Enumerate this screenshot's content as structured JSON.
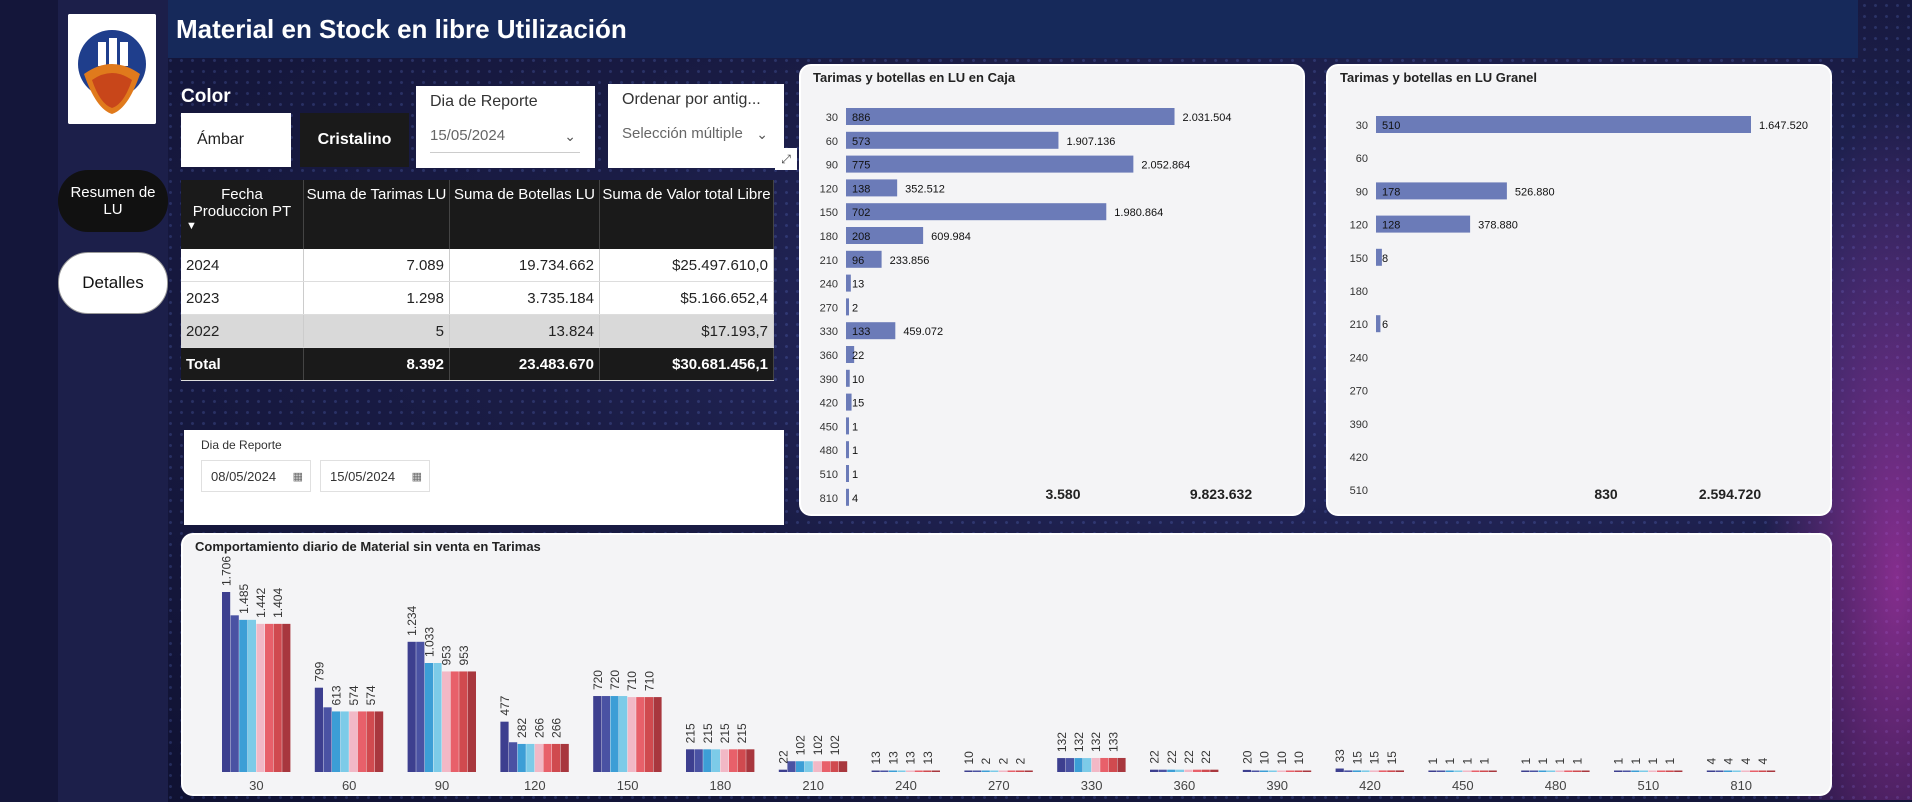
{
  "title": "Material en Stock en libre Utilización",
  "logo": {
    "alt": "Perlas Tierra Blanca logo"
  },
  "nav": {
    "resumen": "Resumen de LU",
    "detalles": "Detalles"
  },
  "filters": {
    "color_label": "Color",
    "color_options": [
      "Ámbar",
      "Cristalino"
    ],
    "dia_label": "Dia de Reporte",
    "dia_value": "15/05/2024",
    "ordenar_label": "Ordenar por antig...",
    "ordenar_value": "Selección múltiple"
  },
  "table": {
    "headers": [
      "Fecha Produccion PT",
      "Suma de Tarimas LU",
      "Suma de Botellas LU",
      "Suma de Valor total Libre"
    ],
    "rows": [
      [
        "2024",
        "7.089",
        "19.734.662",
        "$25.497.610,0"
      ],
      [
        "2023",
        "1.298",
        "3.735.184",
        "$5.166.652,4"
      ],
      [
        "2022",
        "5",
        "13.824",
        "$17.193,7"
      ]
    ],
    "total": [
      "Total",
      "8.392",
      "23.483.670",
      "$30.681.456,1"
    ]
  },
  "range": {
    "label": "Dia de Reporte",
    "from": "08/05/2024",
    "to": "15/05/2024"
  },
  "colors": {
    "bar": "#6b7bb8",
    "series": [
      "#3d3f8f",
      "#4a52a3",
      "#3c9ed6",
      "#7ccbe8",
      "#f2b8c6",
      "#e8606a",
      "#d04a4f",
      "#a8373e"
    ]
  },
  "chart_data": [
    {
      "type": "bar",
      "title": "Tarimas y botellas en LU en Caja",
      "categories": [
        "30",
        "60",
        "90",
        "120",
        "150",
        "180",
        "210",
        "240",
        "270",
        "330",
        "360",
        "390",
        "420",
        "450",
        "480",
        "510",
        "810"
      ],
      "series": [
        {
          "values": [
            886,
            573,
            775,
            138,
            702,
            208,
            96,
            13,
            2,
            133,
            22,
            10,
            15,
            1,
            1,
            1,
            4
          ]
        },
        {
          "values": [
            2031504,
            1907136,
            2052864,
            352512,
            1980864,
            609984,
            233856,
            null,
            null,
            459072,
            null,
            null,
            null,
            null,
            null,
            null,
            null
          ]
        }
      ],
      "value_labels": [
        "2.031.504",
        "1.907.136",
        "2.052.864",
        "352.512",
        "1.980.864",
        "609.984",
        "233.856",
        "",
        "",
        "459.072",
        "",
        "",
        "",
        "",
        "",
        "",
        ""
      ],
      "totals": [
        "3.580",
        "9.823.632"
      ]
    },
    {
      "type": "bar",
      "title": "Tarimas y botellas en LU Granel",
      "categories": [
        "30",
        "60",
        "90",
        "120",
        "150",
        "180",
        "210",
        "240",
        "270",
        "390",
        "420",
        "510"
      ],
      "series": [
        {
          "values": [
            510,
            null,
            178,
            128,
            8,
            null,
            6,
            null,
            null,
            null,
            null,
            null
          ]
        },
        {
          "values": [
            1647520,
            null,
            526880,
            378880,
            null,
            null,
            null,
            null,
            null,
            null,
            null,
            null
          ]
        }
      ],
      "value_labels": [
        "1.647.520",
        "",
        "526.880",
        "378.880",
        "",
        "",
        "",
        "",
        "",
        "",
        "",
        ""
      ],
      "totals": [
        "830",
        "2.594.720"
      ]
    },
    {
      "type": "bar",
      "title": "Comportamiento diario de Material sin venta en Tarimas",
      "categories": [
        "30",
        "60",
        "90",
        "120",
        "150",
        "180",
        "210",
        "240",
        "270",
        "330",
        "360",
        "390",
        "420",
        "450",
        "480",
        "510",
        "810"
      ],
      "groups": [
        [
          1706,
          1485,
          1442,
          1442,
          1404,
          1404,
          1404,
          1404
        ],
        [
          799,
          613,
          574,
          574,
          574,
          574,
          574,
          574
        ],
        [
          1234,
          1234,
          1033,
          1033,
          953,
          953,
          953,
          953
        ],
        [
          477,
          282,
          266,
          266,
          266,
          266,
          266,
          266
        ],
        [
          720,
          720,
          720,
          720,
          710,
          710,
          710,
          710
        ],
        [
          215,
          215,
          215,
          215,
          215,
          215,
          215,
          215
        ],
        [
          22,
          102,
          102,
          102,
          102,
          102,
          102,
          102
        ],
        [
          13,
          13,
          13,
          13,
          13,
          13,
          13,
          13
        ],
        [
          10,
          2,
          2,
          2,
          2,
          2,
          2,
          2
        ],
        [
          132,
          132,
          132,
          132,
          133,
          133,
          133,
          133
        ],
        [
          22,
          22,
          22,
          22,
          22,
          22,
          22,
          22
        ],
        [
          20,
          10,
          10,
          10,
          10,
          10,
          10,
          10
        ],
        [
          33,
          15,
          15,
          15,
          15,
          15,
          15,
          15
        ],
        [
          1,
          1,
          1,
          1,
          1,
          1,
          1,
          1
        ],
        [
          1,
          1,
          1,
          1,
          1,
          1,
          1,
          1
        ],
        [
          1,
          1,
          1,
          1,
          1,
          1,
          1,
          1
        ],
        [
          4,
          4,
          4,
          4,
          4,
          4,
          4,
          4
        ]
      ],
      "group_labels": [
        [
          "1.706",
          "1.485",
          "1.442",
          "1.404"
        ],
        [
          "799",
          "613",
          "574",
          "574"
        ],
        [
          "1.234",
          "1.033",
          "953",
          "953"
        ],
        [
          "477",
          "282",
          "266",
          "266"
        ],
        [
          "720",
          "720",
          "710",
          "710"
        ],
        [
          "215",
          "215",
          "215",
          "215"
        ],
        [
          "22",
          "102",
          "102",
          "102"
        ],
        [
          "13",
          "13",
          "13",
          "13"
        ],
        [
          "10",
          "2",
          "2",
          "2"
        ],
        [
          "132",
          "132",
          "132",
          "133"
        ],
        [
          "22",
          "22",
          "22",
          "22"
        ],
        [
          "20",
          "10",
          "10",
          "10"
        ],
        [
          "33",
          "15",
          "15",
          "15"
        ],
        [
          "1",
          "1",
          "1",
          "1"
        ],
        [
          "1",
          "1",
          "1",
          "1"
        ],
        [
          "1",
          "1",
          "1",
          "1"
        ],
        [
          "4",
          "4",
          "4",
          "4"
        ]
      ]
    }
  ]
}
